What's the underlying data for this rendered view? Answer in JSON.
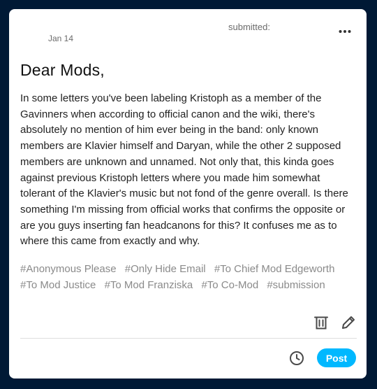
{
  "post": {
    "header": {
      "submitted_label": "submitted:",
      "date": "Jan 14",
      "more_icon": "more-horizontal-icon"
    },
    "title": "Dear Mods,",
    "body": "In some letters you've been labeling Kristoph as a member of the Gavinners when according to official canon and the wiki, there's absolutely no mention of him ever being in the band: only known members are Klavier himself and Daryan, while the other 2 supposed members are unknown and unnamed. Not only that, this kinda goes against previous Kristoph letters where you made him somewhat tolerant of the Klavier's music but not fond of the genre overall. Is there something I'm missing from official works that confirms the opposite or are you guys inserting fan headcanons for this? It confuses me as to where this came from exactly and why.",
    "tags": [
      "#Anonymous Please",
      "#Only Hide Email",
      "#To Chief Mod Edgeworth",
      "#To Mod Justice",
      "#To Mod Franziska",
      "#To Co-Mod",
      "#submission"
    ],
    "actions": {
      "delete_icon": "trash-icon",
      "edit_icon": "pencil-icon",
      "schedule_icon": "clock-icon",
      "post_label": "Post"
    }
  },
  "colors": {
    "background": "#001935",
    "card": "#ffffff",
    "accent": "#00b8ff",
    "tag_text": "#8a8a8a"
  }
}
